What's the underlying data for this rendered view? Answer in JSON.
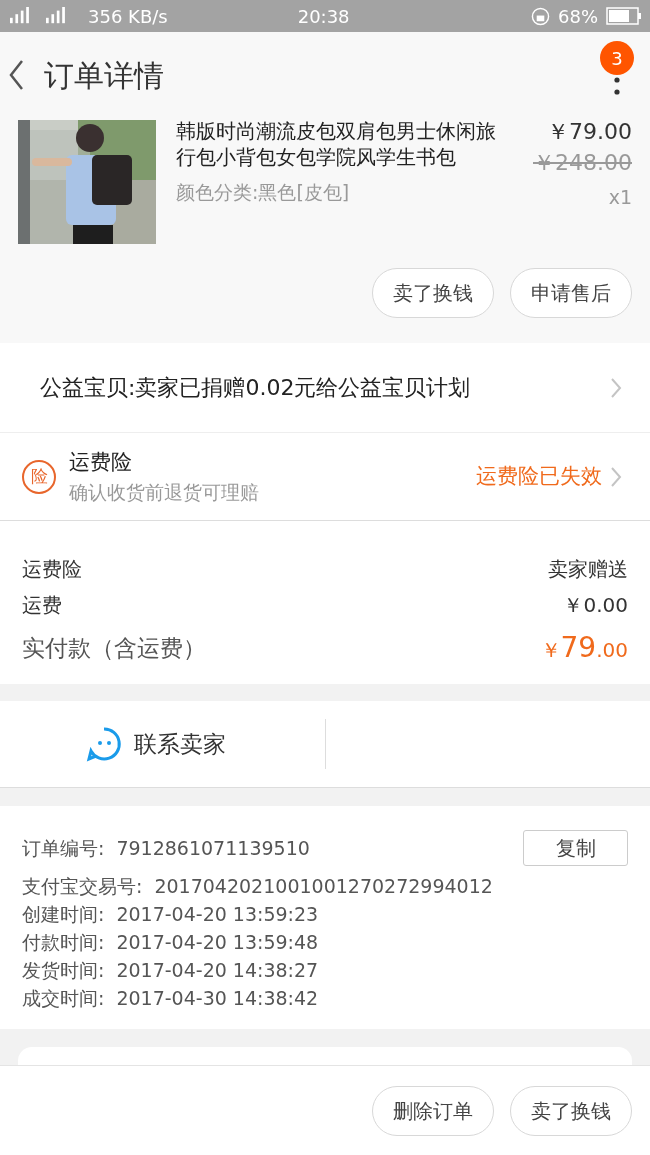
{
  "status_bar": {
    "network": "356 KB/s",
    "time": "20:38",
    "battery": "68%"
  },
  "header": {
    "title": "订单详情",
    "badge": "3"
  },
  "product": {
    "title_lines": [
      "韩版时尚潮流皮包双肩包男士休闲旅",
      "行包小背包女包学院风学生书包"
    ],
    "sku": "颜色分类:黑色[皮包]",
    "price": "￥79.00",
    "original_price": "￥248.00",
    "quantity": "x1",
    "buttons": [
      "卖了换钱",
      "申请售后"
    ]
  },
  "charity": {
    "text": "公益宝贝:卖家已捐赠0.02元给公益宝贝计划"
  },
  "insurance": {
    "icon_text": "险",
    "title": "运费险",
    "subtitle": "确认收货前退货可理赔",
    "status": "运费险已失效"
  },
  "fees": [
    {
      "label": "运费险",
      "value": "卖家赠送",
      "kind": "plain"
    },
    {
      "label": "运费",
      "value": "￥0.00",
      "kind": "plain"
    },
    {
      "label": "实付款（含运费）",
      "currency": "￥",
      "value": "79",
      "decimals": ".00",
      "kind": "total"
    }
  ],
  "contact": {
    "label": "联系卖家"
  },
  "order_info": {
    "copy_button": "复制",
    "rows": [
      {
        "label": "订单编号:",
        "value": "7912861071139510"
      },
      {
        "label": "支付宝交易号:",
        "value": "2017042021001001270272994012"
      },
      {
        "label": "创建时间:",
        "value": "2017-04-20 13:59:23"
      },
      {
        "label": "付款时间:",
        "value": "2017-04-20 13:59:48"
      },
      {
        "label": "发货时间:",
        "value": "2017-04-20 14:38:27"
      },
      {
        "label": "成交时间:",
        "value": "2017-04-30 14:38:42"
      }
    ]
  },
  "bottom_buttons": [
    "删除订单",
    "卖了换钱"
  ]
}
